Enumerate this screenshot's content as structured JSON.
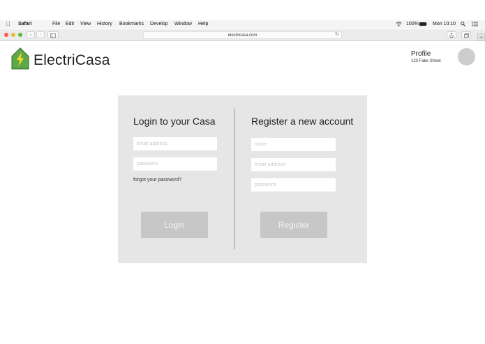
{
  "menubar": {
    "app": "Safari",
    "items": [
      "File",
      "Edit",
      "View",
      "History",
      "Bookmarks",
      "Develop",
      "Window",
      "Help"
    ],
    "battery": "100%",
    "clock": "Mon 10:10"
  },
  "browser": {
    "url": "electricasa.com"
  },
  "header": {
    "brand": "ElectriCasa",
    "profile_title": "Profile",
    "profile_address": "123 Fake Street"
  },
  "login": {
    "heading": "Login to your Casa",
    "email_placeholder": "email address",
    "password_placeholder": "password",
    "forgot": "forgot your password?",
    "button": "Login"
  },
  "register": {
    "heading": "Register a new account",
    "name_placeholder": "name",
    "email_placeholder": "email address",
    "password_placeholder": "password",
    "button": "Register"
  },
  "colors": {
    "logo_green": "#5da848",
    "logo_bolt": "#f2e33a",
    "panel_bg": "#e6e6e6",
    "button_bg": "#c7c7c7"
  }
}
